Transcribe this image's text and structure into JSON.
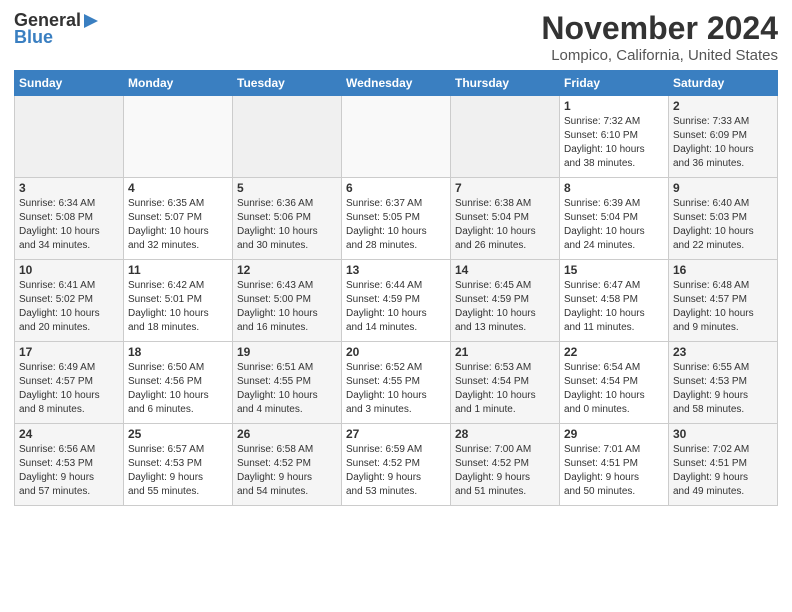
{
  "header": {
    "logo_general": "General",
    "logo_blue": "Blue",
    "month": "November 2024",
    "location": "Lompico, California, United States"
  },
  "calendar": {
    "days_of_week": [
      "Sunday",
      "Monday",
      "Tuesday",
      "Wednesday",
      "Thursday",
      "Friday",
      "Saturday"
    ],
    "weeks": [
      [
        {
          "day": "",
          "info": ""
        },
        {
          "day": "",
          "info": ""
        },
        {
          "day": "",
          "info": ""
        },
        {
          "day": "",
          "info": ""
        },
        {
          "day": "",
          "info": ""
        },
        {
          "day": "1",
          "info": "Sunrise: 7:32 AM\nSunset: 6:10 PM\nDaylight: 10 hours\nand 38 minutes."
        },
        {
          "day": "2",
          "info": "Sunrise: 7:33 AM\nSunset: 6:09 PM\nDaylight: 10 hours\nand 36 minutes."
        }
      ],
      [
        {
          "day": "3",
          "info": "Sunrise: 6:34 AM\nSunset: 5:08 PM\nDaylight: 10 hours\nand 34 minutes."
        },
        {
          "day": "4",
          "info": "Sunrise: 6:35 AM\nSunset: 5:07 PM\nDaylight: 10 hours\nand 32 minutes."
        },
        {
          "day": "5",
          "info": "Sunrise: 6:36 AM\nSunset: 5:06 PM\nDaylight: 10 hours\nand 30 minutes."
        },
        {
          "day": "6",
          "info": "Sunrise: 6:37 AM\nSunset: 5:05 PM\nDaylight: 10 hours\nand 28 minutes."
        },
        {
          "day": "7",
          "info": "Sunrise: 6:38 AM\nSunset: 5:04 PM\nDaylight: 10 hours\nand 26 minutes."
        },
        {
          "day": "8",
          "info": "Sunrise: 6:39 AM\nSunset: 5:04 PM\nDaylight: 10 hours\nand 24 minutes."
        },
        {
          "day": "9",
          "info": "Sunrise: 6:40 AM\nSunset: 5:03 PM\nDaylight: 10 hours\nand 22 minutes."
        }
      ],
      [
        {
          "day": "10",
          "info": "Sunrise: 6:41 AM\nSunset: 5:02 PM\nDaylight: 10 hours\nand 20 minutes."
        },
        {
          "day": "11",
          "info": "Sunrise: 6:42 AM\nSunset: 5:01 PM\nDaylight: 10 hours\nand 18 minutes."
        },
        {
          "day": "12",
          "info": "Sunrise: 6:43 AM\nSunset: 5:00 PM\nDaylight: 10 hours\nand 16 minutes."
        },
        {
          "day": "13",
          "info": "Sunrise: 6:44 AM\nSunset: 4:59 PM\nDaylight: 10 hours\nand 14 minutes."
        },
        {
          "day": "14",
          "info": "Sunrise: 6:45 AM\nSunset: 4:59 PM\nDaylight: 10 hours\nand 13 minutes."
        },
        {
          "day": "15",
          "info": "Sunrise: 6:47 AM\nSunset: 4:58 PM\nDaylight: 10 hours\nand 11 minutes."
        },
        {
          "day": "16",
          "info": "Sunrise: 6:48 AM\nSunset: 4:57 PM\nDaylight: 10 hours\nand 9 minutes."
        }
      ],
      [
        {
          "day": "17",
          "info": "Sunrise: 6:49 AM\nSunset: 4:57 PM\nDaylight: 10 hours\nand 8 minutes."
        },
        {
          "day": "18",
          "info": "Sunrise: 6:50 AM\nSunset: 4:56 PM\nDaylight: 10 hours\nand 6 minutes."
        },
        {
          "day": "19",
          "info": "Sunrise: 6:51 AM\nSunset: 4:55 PM\nDaylight: 10 hours\nand 4 minutes."
        },
        {
          "day": "20",
          "info": "Sunrise: 6:52 AM\nSunset: 4:55 PM\nDaylight: 10 hours\nand 3 minutes."
        },
        {
          "day": "21",
          "info": "Sunrise: 6:53 AM\nSunset: 4:54 PM\nDaylight: 10 hours\nand 1 minute."
        },
        {
          "day": "22",
          "info": "Sunrise: 6:54 AM\nSunset: 4:54 PM\nDaylight: 10 hours\nand 0 minutes."
        },
        {
          "day": "23",
          "info": "Sunrise: 6:55 AM\nSunset: 4:53 PM\nDaylight: 9 hours\nand 58 minutes."
        }
      ],
      [
        {
          "day": "24",
          "info": "Sunrise: 6:56 AM\nSunset: 4:53 PM\nDaylight: 9 hours\nand 57 minutes."
        },
        {
          "day": "25",
          "info": "Sunrise: 6:57 AM\nSunset: 4:53 PM\nDaylight: 9 hours\nand 55 minutes."
        },
        {
          "day": "26",
          "info": "Sunrise: 6:58 AM\nSunset: 4:52 PM\nDaylight: 9 hours\nand 54 minutes."
        },
        {
          "day": "27",
          "info": "Sunrise: 6:59 AM\nSunset: 4:52 PM\nDaylight: 9 hours\nand 53 minutes."
        },
        {
          "day": "28",
          "info": "Sunrise: 7:00 AM\nSunset: 4:52 PM\nDaylight: 9 hours\nand 51 minutes."
        },
        {
          "day": "29",
          "info": "Sunrise: 7:01 AM\nSunset: 4:51 PM\nDaylight: 9 hours\nand 50 minutes."
        },
        {
          "day": "30",
          "info": "Sunrise: 7:02 AM\nSunset: 4:51 PM\nDaylight: 9 hours\nand 49 minutes."
        }
      ]
    ]
  }
}
